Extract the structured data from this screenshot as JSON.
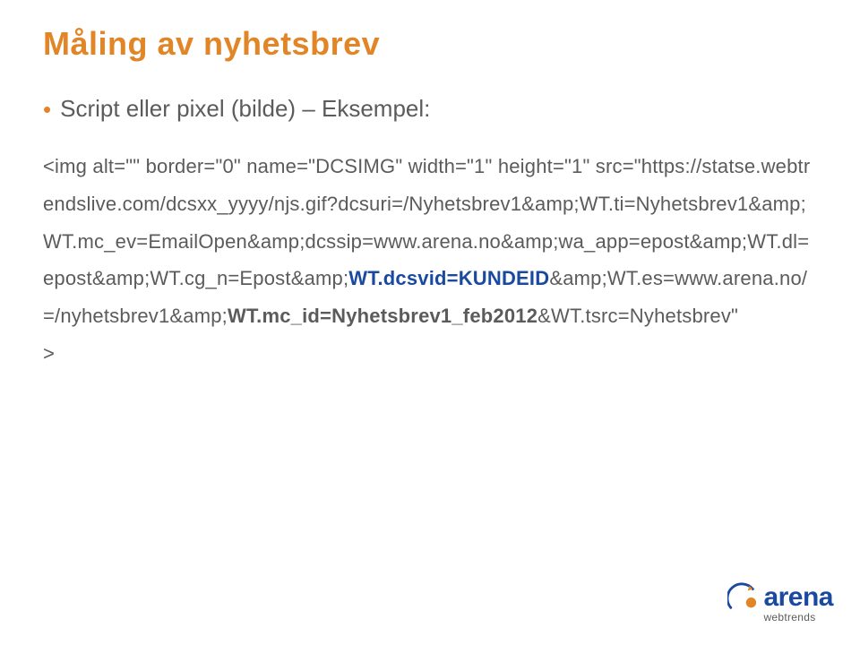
{
  "title": "Måling av nyhetsbrev",
  "bullet": {
    "text": "Script eller pixel (bilde) – Eksempel:"
  },
  "code": {
    "line1_plain": "<img alt=\"\" border=\"0\" name=\"DCSIMG\" width=\"1\" height=\"1\" src=\"https://statse.webtrendslive.com/dcsxx_yyyy/njs.gif?dcsuri=/Nyhetsbrev1&amp;WT.ti=Nyhetsbrev1&amp;WT.mc_ev=EmailOpen&amp;dcssip=www.arena.no&amp;wa_app=epost&amp;WT.dl=epost&amp;WT.cg_n=Epost&amp;",
    "bold_part1": "WT.dcsvid=KUNDEID",
    "mid_plain": "&amp;WT.es=www.arena.no/=/nyhetsbrev1&amp;",
    "bold_part2": "WT.mc_id=Nyhetsbrev1_feb2012",
    "end_plain": "&WT.tsrc=Nyhetsbrev\"",
    "closing": ">"
  },
  "logo": {
    "brand": "arena",
    "sub": "webtrends"
  }
}
